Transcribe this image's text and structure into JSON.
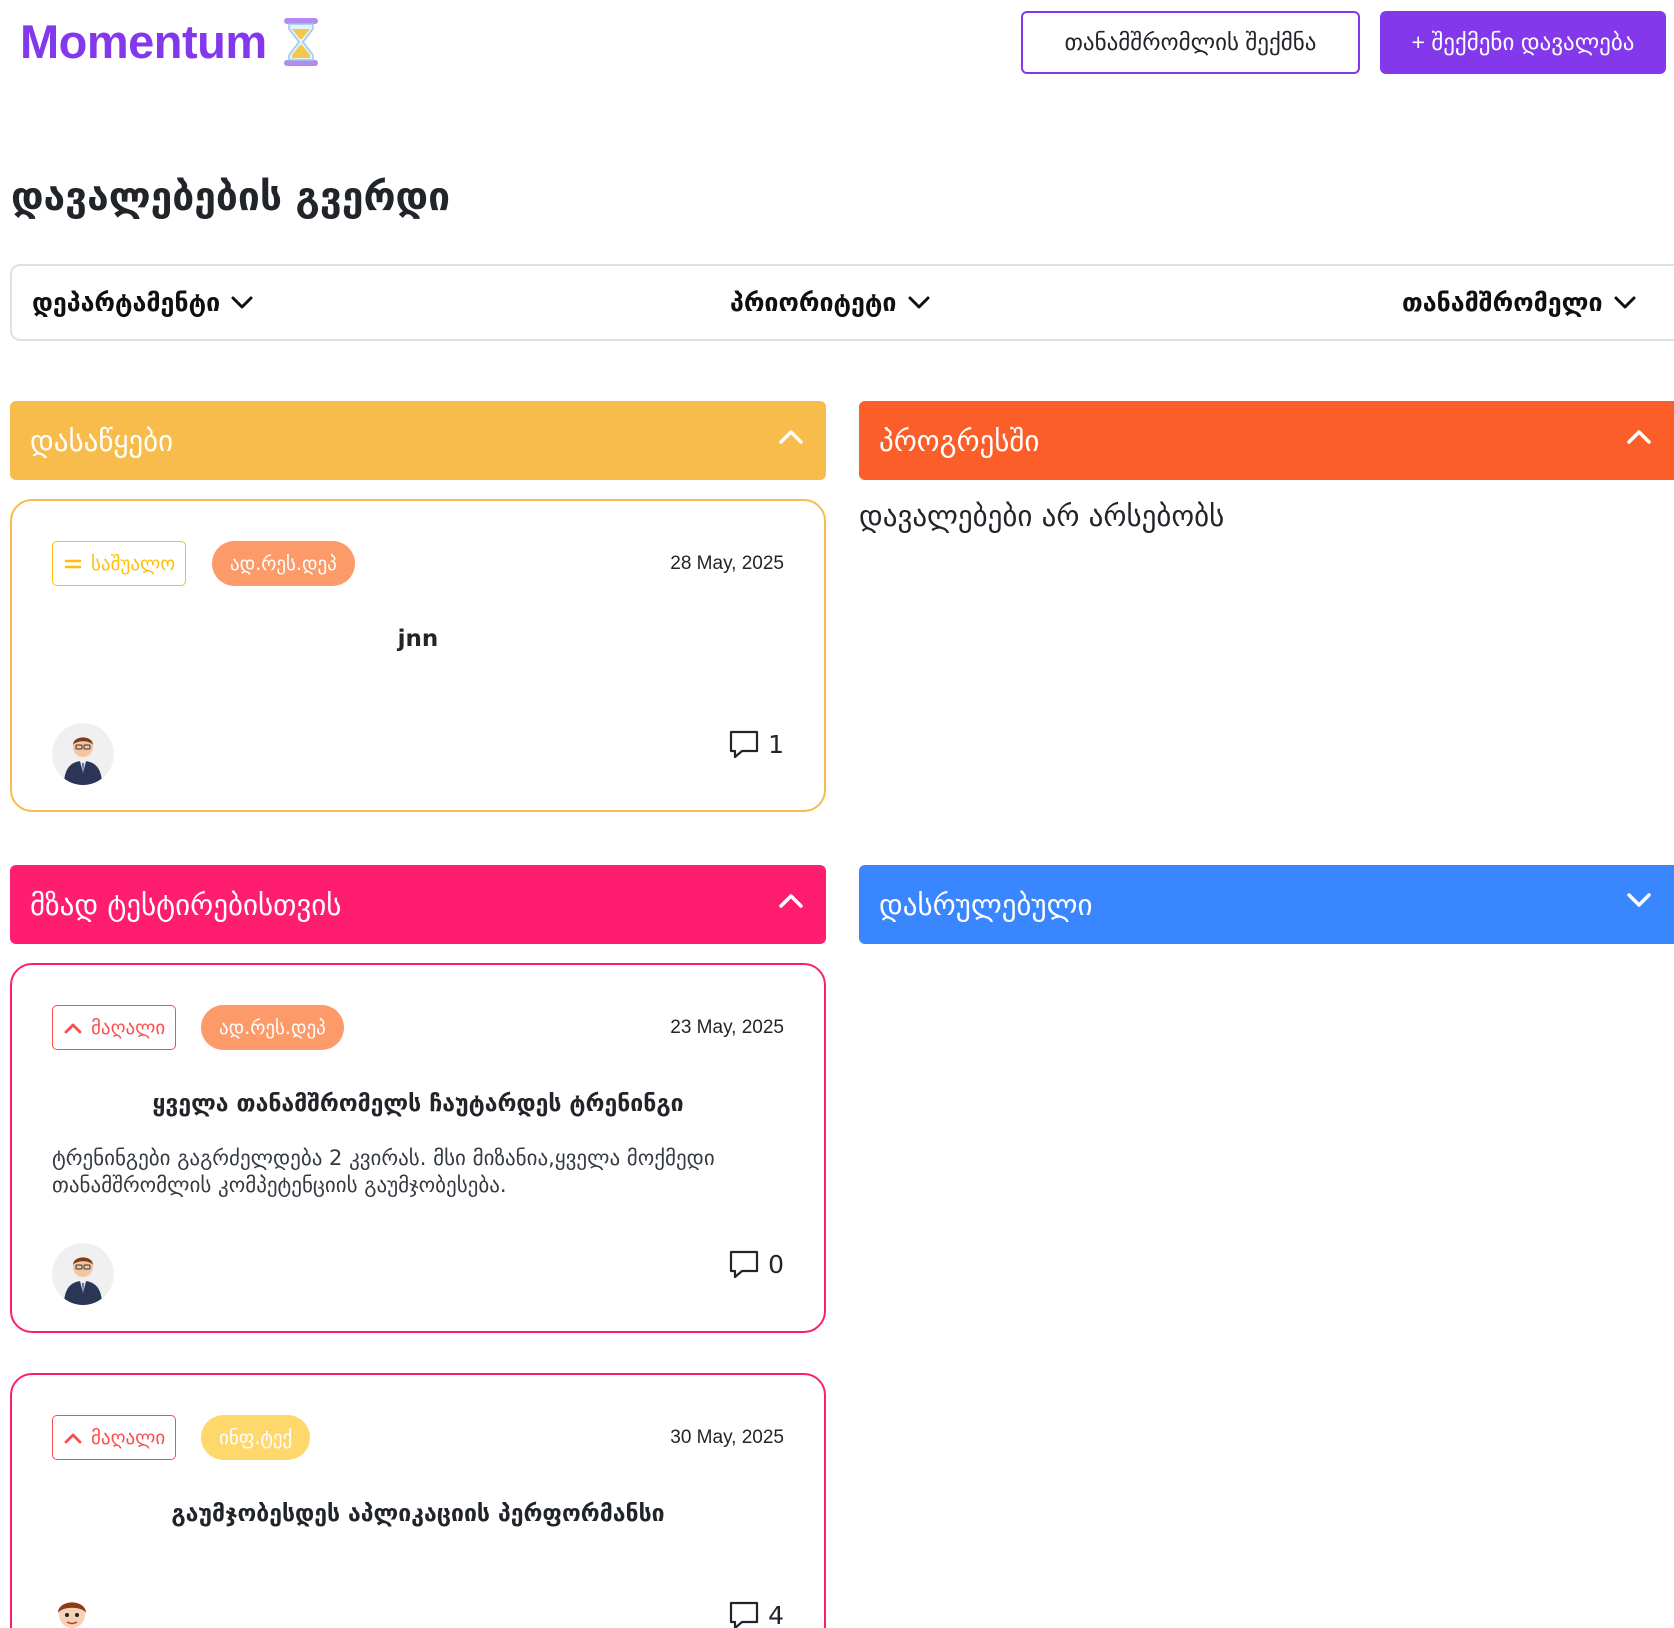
{
  "header": {
    "logo_text": "Momentum",
    "logo_icon": "hourglass-icon",
    "create_employee_label": "თანამშრომლის შექმნა",
    "create_task_label": "+ შექმენი დავალება"
  },
  "page_title": "დავალებების გვერდი",
  "filters": {
    "department": "დეპარტამენტი",
    "priority": "პრიორიტეტი",
    "employee": "თანამშრომელი"
  },
  "colors": {
    "accent": "#8338ec",
    "todo": "#f7bc4c",
    "in_progress": "#fb5e28",
    "ready_for_testing": "#ff1d6f",
    "done": "#3a86ff",
    "dept_design": "#fd9a6a",
    "dept_it": "#ffd86d",
    "priority_medium": "#ffbe0b",
    "priority_high": "#fa4d4d"
  },
  "columns": {
    "todo": {
      "title": "დასაწყები",
      "expanded": true,
      "tasks": [
        {
          "priority": "საშუალო",
          "department": "ად.რეს.დეპ",
          "date": "28 May, 2025",
          "title": "jnn",
          "description": "",
          "comments": "1"
        }
      ]
    },
    "in_progress": {
      "title": "პროგრესში",
      "expanded": true,
      "empty_text": "დავალებები არ არსებობს"
    },
    "ready_for_testing": {
      "title": "მზად ტესტირებისთვის",
      "expanded": true,
      "tasks": [
        {
          "priority": "მაღალი",
          "department": "ად.რეს.დეპ",
          "date": "23 May, 2025",
          "title": "ყველა თანამშრომელს ჩაუტარდეს ტრენინგი",
          "description": "ტრენინგები გაგრძელდება 2 კვირას. მსი მიზანია,ყველა მოქმედი თანამშრომლის კომპეტენციის გაუმჯობესება.",
          "comments": "0"
        },
        {
          "priority": "მაღალი",
          "department": "ინფ.ტექ",
          "date": "30 May, 2025",
          "title": "გაუმჯობესდეს აპლიკაციის პერფორმანსი",
          "description": "",
          "comments": "4"
        }
      ]
    },
    "done": {
      "title": "დასრულებული",
      "expanded": false
    }
  }
}
